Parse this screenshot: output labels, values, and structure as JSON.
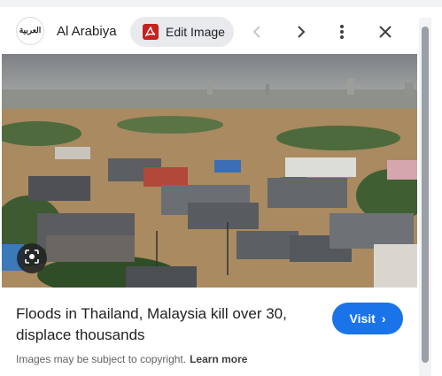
{
  "header": {
    "source_logo_text": "العربية",
    "source_name": "Al Arabiya",
    "edit_label": "Edit Image",
    "icons": {
      "source_logo": "al-arabiya-logo",
      "edit": "pdf-icon",
      "prev": "chevron-left-icon",
      "next": "chevron-right-icon",
      "more": "more-vert-icon",
      "close": "close-icon"
    }
  },
  "image": {
    "alt": "Aerial view of flooded residential neighborhood",
    "lens_icon": "lens-icon"
  },
  "result": {
    "title": "Floods in Thailand, Malaysia kill over 30, displace thousands",
    "visit_label": "Visit",
    "visit_chevron": "›",
    "copyright_text": "Images may be subject to copyright.",
    "learn_more": "Learn more"
  },
  "colors": {
    "accent": "#1a73e8",
    "edit_bg": "#e8eaed",
    "pdf_red": "#c5221f",
    "text": "#202124",
    "muted": "#5f6368"
  }
}
